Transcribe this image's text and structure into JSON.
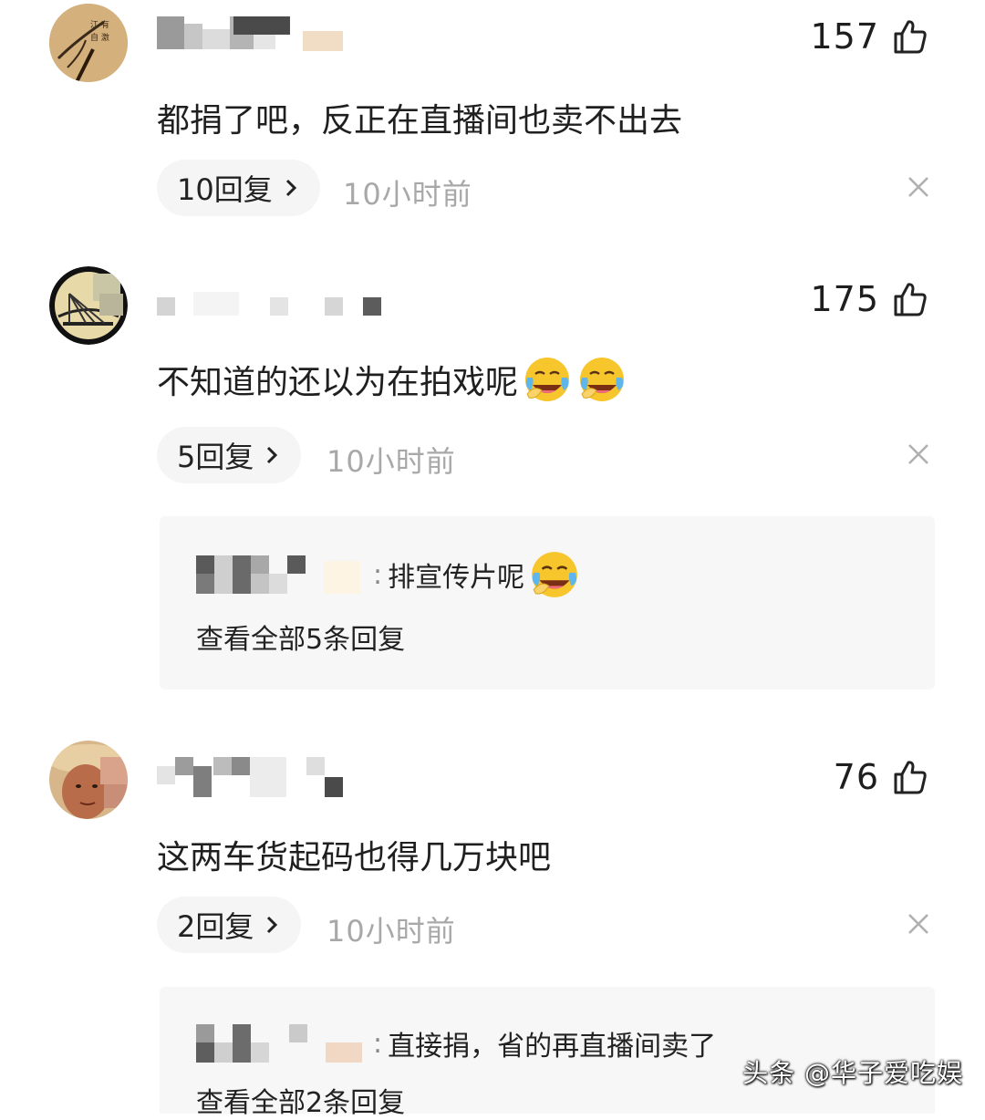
{
  "comments": [
    {
      "likes": "157",
      "text": "都捐了吧，反正在直播间也卖不出去",
      "replies_label": "10回复",
      "time": "10小时前"
    },
    {
      "likes": "175",
      "text": "不知道的还以为在拍戏呢",
      "replies_label": "5回复",
      "time": "10小时前",
      "sub_reply": {
        "text": "排宣传片呢",
        "view_all": "查看全部5条回复"
      }
    },
    {
      "likes": "76",
      "text": "这两车货起码也得几万块吧",
      "replies_label": "2回复",
      "time": "10小时前",
      "sub_reply": {
        "text": "直接捐，省的再直播间卖了",
        "view_all": "查看全部2条回复"
      }
    }
  ],
  "icons": {
    "like": "thumbs-up-outline-icon",
    "close": "close-x-icon",
    "chevron": "chevron-right-icon",
    "emoji": "laughing-crying-emoji"
  },
  "colors": {
    "time_text": "#a8a8a8",
    "pill_bg": "#f5f5f5",
    "subbox_bg": "#f7f7f7"
  },
  "watermark": "头条 @华子爱吃娱"
}
